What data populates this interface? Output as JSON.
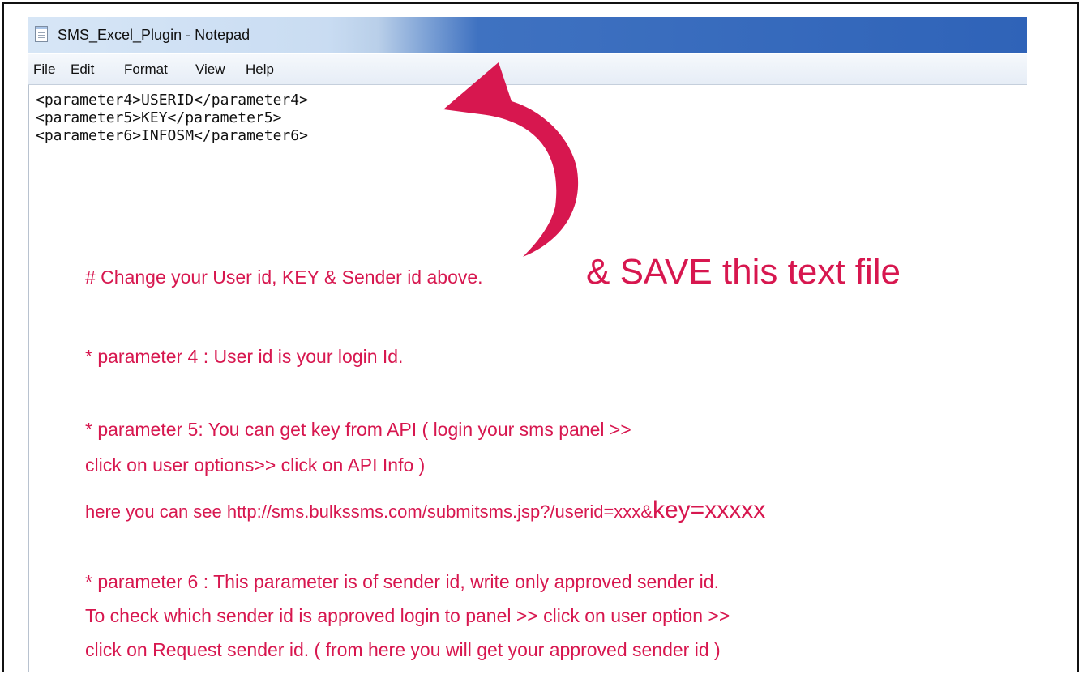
{
  "window": {
    "title": "SMS_Excel_Plugin - Notepad"
  },
  "menu": [
    "File",
    "Edit",
    "Format",
    "View",
    "Help"
  ],
  "editor_lines": [
    "<parameter4>USERID</parameter4>",
    "<parameter5>KEY</parameter5>",
    "<parameter6>INFOSM</parameter6>"
  ],
  "annotations": {
    "change_line": "# Change your User id, KEY & Sender id above.",
    "save_line": "& SAVE this text file",
    "p4": "* parameter 4 : User id is your login Id.",
    "p5_line1": "* parameter 5: You can get key from API ( login your sms panel >>",
    "p5_line2": "click on user options>> click on API Info )",
    "p5_line3_a": "here you can see http://sms.bulkssms.com/submitsms.jsp?/userid=xxx&",
    "p5_line3_b": "key=xxxxx",
    "p6_line1": "* parameter 6 : This parameter is of sender id, write only approved sender id.",
    "p6_line2": "To check which sender id is approved login to panel >> click on user option >>",
    "p6_line3": "click on Request sender id. ( from here you will get your approved sender id )"
  },
  "colors": {
    "accent": "#d7174f",
    "title_blue": "#2f63b8"
  }
}
